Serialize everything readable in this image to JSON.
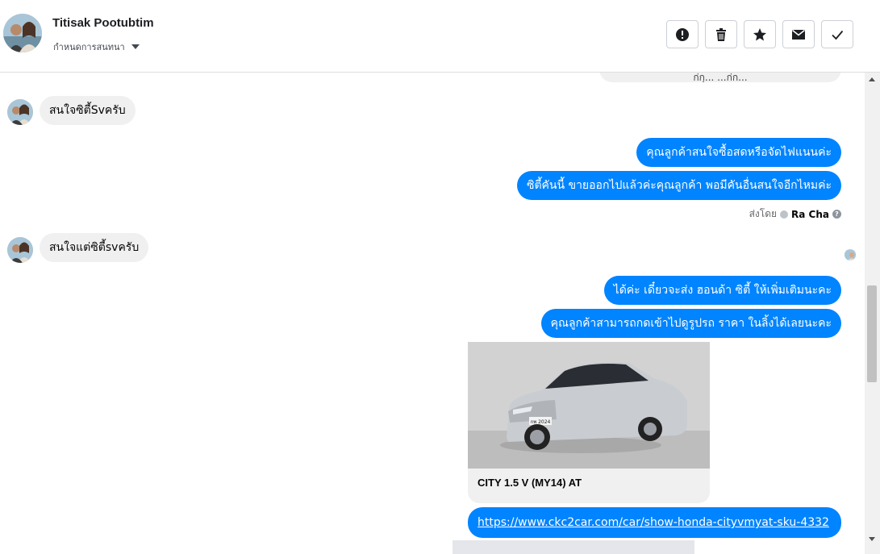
{
  "header": {
    "user_name": "Titisak Pootubtim",
    "assign_label": "กำหนดการสนทนา",
    "buttons": [
      {
        "name": "spam",
        "icon": "alert-circle-icon"
      },
      {
        "name": "delete",
        "icon": "trash-icon"
      },
      {
        "name": "star",
        "icon": "star-icon"
      },
      {
        "name": "mark-unread",
        "icon": "envelope-icon"
      },
      {
        "name": "done",
        "icon": "check-icon"
      }
    ]
  },
  "messages": {
    "partial_top": "ก่กุ... ...ก่ก...",
    "in_1": "สนใจซิตี้Svครับ",
    "out_1": "คุณลูกค้าสนใจซื้อสดหรือจัดไฟแนนค่ะ",
    "out_2": "ซิตี้คันนี้ ขายออกไปแล้วค่ะคุณลูกค้า พอมีคันอื่นสนใจอีกไหมค่ะ",
    "sent_by_label": "ส่งโดย",
    "sent_by_name": "Ra Cha",
    "in_2": "สนใจแต่ซิตี้svครับ",
    "out_3": "ได้ค่ะ เดี๋ยวจะส่ง ฮอนด้า ซิตี้ ให้เพิ่มเติมนะคะ",
    "out_4": "คุณลูกค้าสามารถกดเข้าไปดูรูปรถ ราคา ในลิ้งได้เลยนะคะ",
    "card_title": "CITY 1.5 V (MY14) AT",
    "card_plate": "กพ 2024",
    "link": "https://www.ckc2car.com/car/show-honda-cityvmyat-sku-4332"
  },
  "colors": {
    "accent": "#0084ff",
    "incoming": "#f0f0f0"
  }
}
